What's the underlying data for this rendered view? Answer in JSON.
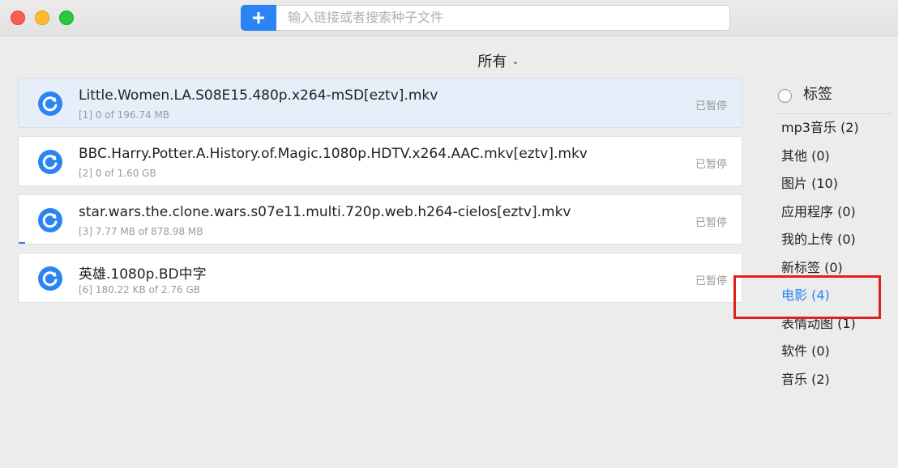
{
  "toolbar": {
    "add_icon": "plus-icon",
    "search_placeholder": "输入链接或者搜索种子文件"
  },
  "filter": {
    "label": "所有",
    "icon": "chevron-down-icon"
  },
  "downloads": [
    {
      "name": "Little.Women.LA.S08E15.480p.x264-mSD[eztv].mkv",
      "meta": "[1] 0 of 196.74 MB",
      "state": "已暂停",
      "progress": 0,
      "selected": true
    },
    {
      "name": "BBC.Harry.Potter.A.History.of.Magic.1080p.HDTV.x264.AAC.mkv[eztv].mkv",
      "meta": "[2] 0 of 1.60 GB",
      "state": "已暂停",
      "progress": 0,
      "selected": false
    },
    {
      "name": "star.wars.the.clone.wars.s07e11.multi.720p.web.h264-cielos[eztv].mkv",
      "meta": "[3] 7.77 MB of 878.98 MB",
      "state": "已暂停",
      "progress": 0.009,
      "selected": false
    },
    {
      "name": "英雄.1080p.BD中字",
      "meta": "[6] 180.22 KB of 2.76 GB",
      "state": "已暂停",
      "progress": 0,
      "selected": false
    }
  ],
  "tags": {
    "title": "标签",
    "items": [
      {
        "label": "mp3音乐 (2)",
        "active": false
      },
      {
        "label": "其他 (0)",
        "active": false
      },
      {
        "label": "图片 (10)",
        "active": false
      },
      {
        "label": "应用程序 (0)",
        "active": false
      },
      {
        "label": "我的上传 (0)",
        "active": false
      },
      {
        "label": "新标签  (0)",
        "active": false
      },
      {
        "label": "电影 (4)",
        "active": true
      },
      {
        "label": "表情动图 (1)",
        "active": false
      },
      {
        "label": "软件 (0)",
        "active": false
      },
      {
        "label": "音乐 (2)",
        "active": false
      }
    ]
  },
  "colors": {
    "accent": "#2b84f3",
    "highlight": "#e02020"
  }
}
